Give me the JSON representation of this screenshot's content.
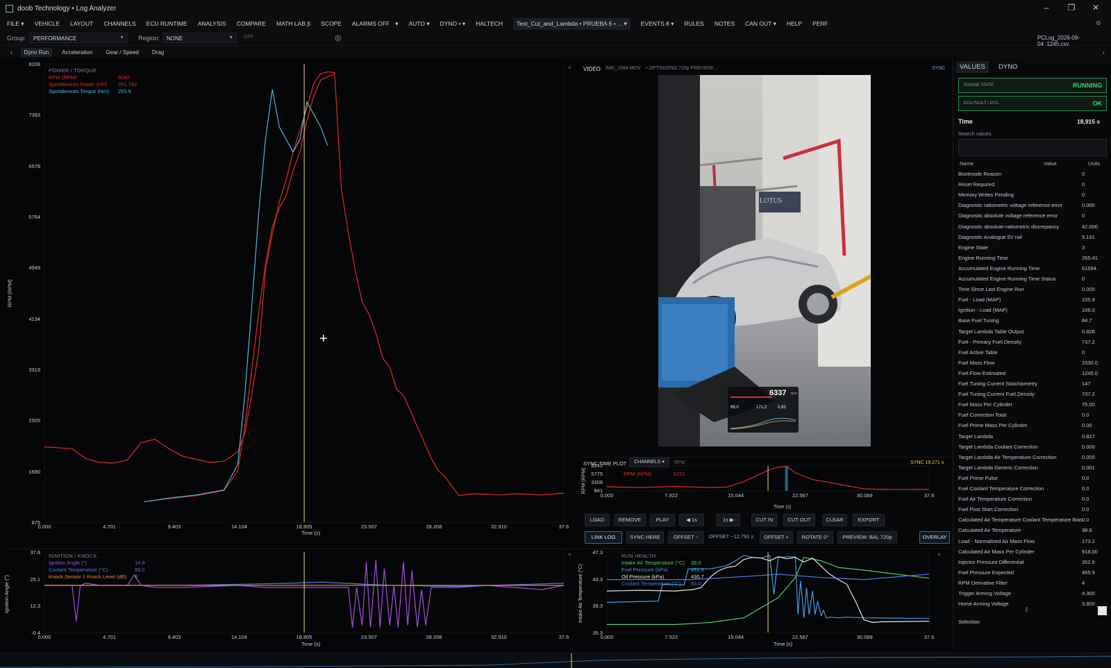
{
  "window": {
    "title": "doob Technology • Log Analyzer",
    "minimize": "–",
    "restore": "❐",
    "close": "✕"
  },
  "menu": {
    "file": "FILE ▾",
    "vehicle": "VEHICLE",
    "layout": "LAYOUT",
    "channels": "CHANNELS",
    "ecu_runtime": "ECU RUNTIME",
    "analysis": "ANALYSIS",
    "compare": "COMPARE",
    "math_lab": "MATH LAB β",
    "scope": "SCOPE",
    "alarms": "ALARMS OFF",
    "alarms_caret": "▾",
    "auto": "AUTO ▾",
    "dyno": "DYNO • ▾",
    "haltech": "HALTECH",
    "log_tab": "Test_Cut_and_Lambda • PRUEBA 6 • ... ▾",
    "events": "EVENTS 8 ▾",
    "rules": "RULES",
    "notes": "NOTES",
    "can_out": "CAN OUT ▾",
    "help": "HELP",
    "perf": "PERF",
    "settings_icon": "⚙"
  },
  "groupbar": {
    "group_label": "Group:",
    "group_value": "PERFORMANCE",
    "region_label": "Region:",
    "region_value": "NONE",
    "off_label": "OFF",
    "target_icon": "◎",
    "filename": "PCLog_2026-09-04_1245.csv"
  },
  "subtabs": {
    "back": "‹",
    "dyno_run": "Dyno Run",
    "acceleration": "Acceleration",
    "gear_speed": "Gear / Speed",
    "drag": "Drag",
    "forward": "‹"
  },
  "main_chart": {
    "title": "POWER / TORQUE",
    "ylabel": "RPM (RPM)",
    "xlabel": "Time (s)",
    "yticks": [
      "8208",
      "7393",
      "6578",
      "5764",
      "4949",
      "4134",
      "3319",
      "2505",
      "1690",
      "875"
    ],
    "xticks": [
      "0.000",
      "4.701",
      "9.403",
      "14.104",
      "18.805",
      "23.507",
      "28.208",
      "32.910",
      "37.6"
    ],
    "legend": [
      {
        "name": "RPM (RPM)",
        "value": "6082",
        "color": "#e02a2a"
      },
      {
        "name": "Sportdevices Power (HP)",
        "value": "251.792",
        "color": "#e02a2a"
      },
      {
        "name": "Sportdevices Torque (Nm)",
        "value": "293.5",
        "color": "#4fb8e0"
      }
    ],
    "menu_icon": "≡",
    "cursor_icon": "+"
  },
  "chart_data": [
    {
      "type": "line",
      "title": "POWER / TORQUE",
      "xlabel": "Time (s)",
      "ylabel": "RPM (RPM)",
      "xlim": [
        0,
        37.6
      ],
      "ylim": [
        875,
        8208
      ],
      "series": [
        {
          "name": "RPM (RPM)",
          "color": "#e02a2a",
          "x": [
            0,
            2,
            3,
            4,
            5,
            6,
            7,
            8,
            9,
            10,
            11,
            12,
            13,
            14,
            14.5,
            15,
            15.5,
            16,
            16.5,
            17,
            17.5,
            18,
            18.5,
            19,
            19.5,
            20,
            20.5,
            21,
            21.5,
            22,
            22.5,
            23,
            23.5,
            24,
            24.5,
            25,
            25.5,
            26,
            26.5,
            27,
            27.5,
            28,
            28.5,
            29,
            29.5,
            30,
            31,
            32,
            33,
            34,
            35,
            36,
            37.6
          ],
          "y": [
            2080,
            2050,
            1890,
            1830,
            1820,
            1870,
            2150,
            2200,
            2050,
            1930,
            1880,
            1830,
            1850,
            2000,
            2300,
            2900,
            3600,
            4900,
            5500,
            6000,
            6350,
            6800,
            7150,
            7500,
            7900,
            8050,
            8080,
            8070,
            6200,
            5500,
            4900,
            4400,
            4200,
            3900,
            3500,
            3350,
            3000,
            2900,
            2650,
            2400,
            2150,
            1900,
            1700,
            1600,
            1450,
            1300,
            1330,
            1320,
            1310,
            1330,
            1320,
            1310,
            1340
          ]
        },
        {
          "name": "Sportdevices Power (HP)",
          "color": "#e02a2a",
          "x": [
            7.2,
            9,
            11,
            13,
            14,
            14.5,
            15,
            15.5,
            16,
            16.5,
            17,
            17.5,
            18,
            18.5,
            19,
            19.5,
            20,
            20.5,
            21
          ],
          "y": [
            1200,
            1250,
            1300,
            1380,
            1700,
            2400,
            3300,
            4200,
            5000,
            5600,
            5900,
            6100,
            6500,
            6800,
            7300,
            7700,
            7950,
            8000,
            8050
          ]
        },
        {
          "name": "Sportdevices Torque (Nm)",
          "color": "#4fb8e0",
          "x": [
            7.2,
            9,
            11,
            13,
            14,
            14.5,
            15,
            15.5,
            16,
            16.5,
            17,
            17.5,
            18,
            18.5,
            19,
            19.5,
            20,
            20.5
          ],
          "y": [
            1200,
            1260,
            1310,
            1390,
            1800,
            2900,
            4300,
            5800,
            7000,
            7800,
            7200,
            7000,
            6800,
            7000,
            7600,
            7400,
            7200,
            6900
          ]
        }
      ]
    },
    {
      "type": "line",
      "title": "IGNITION / KNOCK",
      "xlabel": "Time (s)",
      "ylabel": "Ignition Angle (°)",
      "xlim": [
        0,
        37.6
      ],
      "ylim": [
        -0.4,
        37.8
      ],
      "series": [
        {
          "name": "Ignition Angle (°)",
          "color": "#a64ee6",
          "x": [
            0,
            2,
            2.3,
            2.6,
            3,
            4,
            6,
            6.5,
            7,
            8,
            9,
            10,
            12,
            14,
            16,
            18,
            20,
            22,
            22.3,
            22.6,
            23,
            23.3,
            23.6,
            24,
            24.3,
            24.6,
            25,
            25.3,
            25.6,
            26,
            26.3,
            26.6,
            27,
            27.3,
            27.6,
            28,
            30,
            32,
            34,
            36,
            37.6
          ],
          "y": [
            22,
            22,
            5,
            22,
            23,
            22,
            22,
            27,
            22,
            21,
            21,
            21,
            21.5,
            22,
            21,
            21,
            21,
            21,
            2,
            21,
            3,
            33,
            2,
            34,
            2,
            30,
            3,
            22,
            2,
            33,
            3,
            29,
            2,
            20,
            3,
            21,
            21,
            22,
            21,
            20,
            22
          ]
        },
        {
          "name": "Coolant Temperature (°C)",
          "color": "#4e7ee6",
          "x": [
            0,
            10,
            18,
            20,
            25,
            30,
            37.6
          ],
          "y": [
            22,
            22,
            23,
            23.5,
            22,
            21.5,
            23
          ]
        },
        {
          "name": "Knock Sensor 1 Knock Level (dB)",
          "color": "#e0883a",
          "x": [
            0,
            37.6
          ],
          "y": [
            22,
            22
          ]
        }
      ]
    },
    {
      "type": "line",
      "title": "SYNC TIME PLOT",
      "xlabel": "Time (s)",
      "ylabel": "RPM (RPM)",
      "xlim": [
        0,
        37.6
      ],
      "ylim": [
        841,
        8242
      ],
      "series": [
        {
          "name": "RPM (RPM)",
          "color": "#e02a2a",
          "x": [
            0,
            4,
            8,
            12,
            14,
            16,
            18,
            19,
            20,
            21,
            22,
            24,
            26,
            28,
            30,
            32,
            34,
            37.6
          ],
          "y": [
            2080,
            1830,
            2200,
            1830,
            2000,
            3600,
            6000,
            7150,
            7900,
            8080,
            6200,
            4200,
            3350,
            2400,
            1450,
            1330,
            1310,
            1340
          ]
        }
      ]
    },
    {
      "type": "line",
      "title": "RUN HEALTH",
      "xlabel": "Time (s)",
      "ylabel": "Intake Air Temperature (°C)",
      "xlim": [
        0,
        37.6
      ],
      "ylim": [
        35.3,
        47.3
      ],
      "series": [
        {
          "name": "Intake Air Temperature (°C)",
          "color": "#4ed26a",
          "x": [
            0,
            8,
            12,
            16,
            20,
            22,
            23,
            25,
            27,
            30,
            37.6
          ],
          "y": [
            36.5,
            36.5,
            36.8,
            37.5,
            40.5,
            43.5,
            46.5,
            46,
            45,
            44.6,
            43.4
          ]
        },
        {
          "name": "Fuel Pressure (kPa)",
          "color": "#3f9ee6",
          "x": [
            0,
            6,
            6.5,
            9,
            9.5,
            12,
            13,
            14,
            15,
            16,
            17,
            18,
            19,
            19.5,
            20,
            21,
            22,
            22.3,
            22.6,
            23,
            23.3,
            23.6,
            24,
            24.3,
            24.6,
            25,
            25.3,
            25.6,
            26,
            27,
            28,
            30,
            37.6
          ],
          "y": [
            39.8,
            40,
            42.5,
            42.4,
            44.8,
            44.8,
            45,
            45.3,
            46,
            46.8,
            46.5,
            46.4,
            46.8,
            41,
            46.5,
            46.6,
            46.6,
            38,
            43,
            37.5,
            42,
            38,
            41.5,
            38,
            40,
            37.8,
            38.6,
            37.5,
            37.6,
            37.5,
            37.6,
            37.5,
            37.4
          ]
        },
        {
          "name": "Oil Pressure (kPa)",
          "color": "#e8e8e8",
          "x": [
            0,
            4,
            8,
            9,
            10,
            11,
            12,
            13,
            14,
            15,
            16,
            17,
            18,
            19,
            20,
            21,
            22,
            23,
            24,
            25,
            26,
            27,
            28,
            29,
            30,
            31,
            32,
            37.6
          ],
          "y": [
            41.5,
            41.6,
            41.5,
            41.6,
            41.7,
            42,
            43.5,
            44.5,
            45,
            45.2,
            46.2,
            46.5,
            46.4,
            46,
            46.6,
            46.3,
            46.5,
            45.8,
            46.4,
            45.2,
            44,
            43.2,
            42.5,
            40,
            37.2,
            36.8,
            36.9,
            37
          ]
        },
        {
          "name": "Coolant Temperature (°C)",
          "color": "#4e7ee6",
          "x": [
            0,
            10,
            18,
            20,
            25,
            30,
            37.6
          ],
          "y": [
            43.2,
            43.2,
            43.8,
            44,
            43.5,
            43.2,
            44
          ]
        }
      ]
    }
  ],
  "knock_chart": {
    "title": "IGNITION / KNOCK",
    "ylabel": "Ignition Angle (°)",
    "xlabel": "Time (s)",
    "yticks": [
      "37.8",
      "25.1",
      "12.3",
      "-0.4"
    ],
    "xticks": [
      "0.000",
      "4.701",
      "9.403",
      "14.104",
      "18.805",
      "23.507",
      "28.208",
      "32.910",
      "37.6"
    ],
    "legend": [
      {
        "name": "Ignition Angle (°)",
        "value": "14.9",
        "color": "#a64ee6"
      },
      {
        "name": "Coolant Temperature (°C)",
        "value": "83.0",
        "color": "#4e7ee6"
      },
      {
        "name": "Knock Sensor 1 Knock Level (dB)",
        "value": "0",
        "color": "#e0883a"
      }
    ],
    "menu_icon": "≡"
  },
  "video": {
    "label": "VIDEO",
    "filename": "IMG_1994.MOV",
    "status": "• OPTIMIZING 720p PREVIEW...",
    "sync": "SYNC",
    "overlay_rpm": "6337",
    "overlay_rpm_unit": "rpm",
    "overlay_v1": "99,0",
    "overlay_v2": "171,2",
    "overlay_v3": "0,85",
    "sign_text": "LOTUS"
  },
  "sync_plot": {
    "title": "SYNC TIME PLOT",
    "channels_btn": "CHANNELS ▾",
    "channel_name": "RPM",
    "sync_value": "SYNC 19,271 s",
    "ylabel": "RPM (RPM)",
    "xlabel": "Time (s)",
    "yticks": [
      "8242",
      "5775",
      "3308",
      "841"
    ],
    "xticks": [
      "0.000",
      "7.522",
      "15.044",
      "22.567",
      "30.089",
      "37.6"
    ],
    "legend_name": "RPM (RPM)",
    "legend_value": "5221"
  },
  "controls": {
    "load": "LOAD",
    "remove": "REMOVE",
    "play": "PLAY",
    "back1s": "◀ 1s",
    "fwd1s": "1s ▶",
    "cut_in": "CUT IN",
    "cut_out": "CUT OUT",
    "clear": "CLEAR",
    "export": "EXPORT",
    "link_log": "LINK LOG",
    "sync_here": "SYNC HERE",
    "offset_minus": "OFFSET −",
    "offset_value": "OFFSET −12,791 s",
    "offset_plus": "OFFSET +",
    "rotate": "ROTATE 0°",
    "preview": "PREVIEW: BAL 720p",
    "overlay": "OVERLAY"
  },
  "run_health": {
    "title": "RUN HEALTH",
    "ylabel": "Intake Air Temperature (°C)",
    "xlabel": "Time (s)",
    "yticks": [
      "47.3",
      "43.3",
      "39.3",
      "35.3"
    ],
    "xticks": [
      "0.000",
      "7.522",
      "15.044",
      "22.567",
      "30.089",
      "37.6"
    ],
    "legend": [
      {
        "name": "Intake Air Temperature (°C)",
        "value": "39.0",
        "color": "#4ed26a"
      },
      {
        "name": "Fuel Pressure (kPa)",
        "value": "461.6",
        "color": "#3f9ee6"
      },
      {
        "name": "Oil Pressure (kPa)",
        "value": "430.7",
        "color": "#e8e8e8"
      },
      {
        "name": "Coolant Temperature (°C)",
        "value": "83.0",
        "color": "#4e7ee6"
      }
    ],
    "menu_icon": "≡"
  },
  "right": {
    "tab_values": "VALUES",
    "tab_dyno": "DYNO",
    "engine_state_label": "ENGINE STATE",
    "engine_state_value": "RUNNING",
    "ecu_fault_label": "ECU FAULT / DTC",
    "ecu_fault_value": "OK",
    "time_label": "Time",
    "time_value": "18,915 s",
    "search_label": "Search values",
    "col_name": "Name",
    "col_value": "Value",
    "col_units": "Units",
    "selection_label": "Selection",
    "rows": [
      {
        "name": "Bootmode Reason",
        "value": "0"
      },
      {
        "name": "Reset Required",
        "value": "0"
      },
      {
        "name": "Memory Writes Pending",
        "value": "0"
      },
      {
        "name": "Diagnostic ratiometric voltage reference error",
        "value": "0.000"
      },
      {
        "name": "Diagnostic absolute voltage reference error",
        "value": "0"
      },
      {
        "name": "Diagnostic absolute-ratiometric discrepancy",
        "value": "42.000"
      },
      {
        "name": "Diagnostic Analogue 5V rail",
        "value": "5.131"
      },
      {
        "name": "Engine State",
        "value": "3"
      },
      {
        "name": "Engine Running Time",
        "value": "265.41"
      },
      {
        "name": "Accumulated Engine Running Time",
        "value": "61594."
      },
      {
        "name": "Accumulated Engine Running Time Status",
        "value": "0"
      },
      {
        "name": "Time Since Last Engine Run",
        "value": "0.000"
      },
      {
        "name": "Fuel - Load (MAP)",
        "value": "105.9"
      },
      {
        "name": "Ignition - Load (MAP)",
        "value": "106.0"
      },
      {
        "name": "Base Fuel Tuning",
        "value": "84.7"
      },
      {
        "name": "Target Lambda Table Output",
        "value": "0.826"
      },
      {
        "name": "Fuel - Primary Fuel Density",
        "value": "737.2"
      },
      {
        "name": "Fuel Active Table",
        "value": "0"
      },
      {
        "name": "Fuel Mass Flow",
        "value": "1530.0"
      },
      {
        "name": "Fuel Flow Estimated",
        "value": "1245.0"
      },
      {
        "name": "Fuel Tuning Current Stoichiometry",
        "value": "147"
      },
      {
        "name": "Fuel Tuning Current Fuel Density",
        "value": "737.2"
      },
      {
        "name": "Fuel Mass Per Cylinder",
        "value": "75.00"
      },
      {
        "name": "Fuel Correction Total",
        "value": "0.0"
      },
      {
        "name": "Fuel Prime Mass Per Cylinder",
        "value": "0.00"
      },
      {
        "name": "Target Lambda",
        "value": "0.827"
      },
      {
        "name": "Target Lambda Coolant Correction",
        "value": "0.000"
      },
      {
        "name": "Target Lambda Air Temperature Correction",
        "value": "0.000"
      },
      {
        "name": "Target Lambda Generic Correction",
        "value": "0.001"
      },
      {
        "name": "Fuel Prime Pulse",
        "value": "0.0"
      },
      {
        "name": "Fuel Coolant Temperature Correction",
        "value": "0.0"
      },
      {
        "name": "Fuel Air Temperature Correction",
        "value": "0.0"
      },
      {
        "name": "Fuel Post Start Correction",
        "value": "0.0"
      },
      {
        "name": "Calculated Air Temperature Coolant Temperature Bias",
        "value": "0.0"
      },
      {
        "name": "Calculated Air Temperature",
        "value": "38.8"
      },
      {
        "name": "Load - Normalised Air Mass Flow",
        "value": "173.2"
      },
      {
        "name": "Calculated Air Mass Per Cylinder",
        "value": "918.00"
      },
      {
        "name": "Injector Pressure Differential",
        "value": "352.6"
      },
      {
        "name": "Fuel Pressure Expected",
        "value": "465.9"
      },
      {
        "name": "RPM Derivative Filter",
        "value": "4"
      },
      {
        "name": "Trigger Arming Voltage",
        "value": "4.300"
      },
      {
        "name": "Home Arming Voltage",
        "value": "3.800"
      }
    ]
  },
  "colors": {
    "accent": "#2d6fa0",
    "running": "#39d273",
    "cursor": "#e8d98a",
    "rpm": "#e02a2a",
    "torque": "#4fb8e0"
  }
}
